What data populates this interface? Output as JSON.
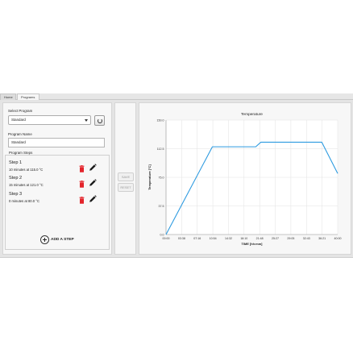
{
  "tabs": [
    {
      "label": "Home"
    },
    {
      "label": "Programs"
    }
  ],
  "program": {
    "select_label": "Select Program",
    "selected": "Standard",
    "name_label": "Program Name",
    "name_value": "Standard",
    "steps_label": "Program Steps",
    "steps": [
      {
        "title": "Step 1",
        "desc": "10 minutes at 115.0 °C"
      },
      {
        "title": "Step 2",
        "desc": "15 minutes at 121.0 °C"
      },
      {
        "title": "Step 3",
        "desc": "0 minutes at 80.0 °C"
      }
    ],
    "add_step_label": "ADD A STEP"
  },
  "actions": {
    "save_label": "SAVE",
    "reset_label": "RESET"
  },
  "colors": {
    "accent": "#2e9be0",
    "delete": "#e3242b",
    "edit": "#1a1a1a"
  },
  "chart_data": {
    "type": "line",
    "title": "Temperature",
    "xlabel": "TIME [hh:mm]",
    "ylabel": "Temperature [°C]",
    "x_ticks": [
      "00:00",
      "03:38",
      "07:16",
      "10:54",
      "14:32",
      "18:10",
      "21:48",
      "25:27",
      "29:05",
      "32:43",
      "36:21",
      "40:00"
    ],
    "y_ticks": [
      "0.0",
      "37.5",
      "75.0",
      "112.5",
      "150.0"
    ],
    "xlim": [
      0,
      40
    ],
    "ylim": [
      0,
      150
    ],
    "grid": true,
    "series": [
      {
        "x": [
          0,
          10.8,
          11.5,
          20.9,
          22.1,
          35.7,
          36.3,
          40.0
        ],
        "y": [
          0,
          115,
          115,
          115,
          121,
          121,
          121,
          80
        ]
      }
    ]
  }
}
